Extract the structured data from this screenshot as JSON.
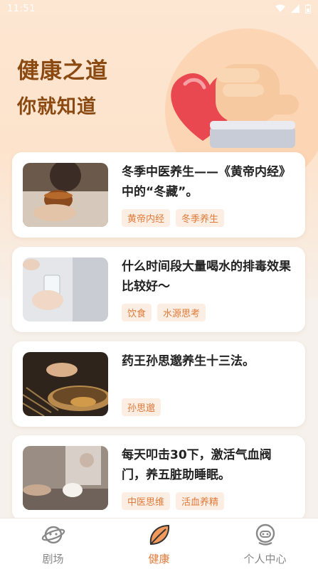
{
  "status_bar": {
    "time": "11:51"
  },
  "hero": {
    "line1": "健康之道",
    "line2": "你就知道"
  },
  "articles": [
    {
      "title": "冬季中医养生——《黄帝内经》中的“冬藏”。",
      "tags": [
        "黄帝内经",
        "冬季养生"
      ]
    },
    {
      "title": "什么时间段大量喝水的排毒效果比较好～",
      "tags": [
        "饮食",
        "水源思考"
      ]
    },
    {
      "title": "药王孙思邈养生十三法。",
      "tags": [
        "孙思邈"
      ]
    },
    {
      "title": "每天叩击30下，激活气血阀门，养五脏助睡眠。",
      "tags": [
        "中医思维",
        "活血养精"
      ]
    }
  ],
  "tabbar": {
    "items": [
      {
        "label": "剧场",
        "icon": "planet-icon"
      },
      {
        "label": "健康",
        "icon": "leaf-icon"
      },
      {
        "label": "个人中心",
        "icon": "robot-icon"
      }
    ],
    "active_index": 1
  },
  "colors": {
    "accent": "#e07a3a",
    "headline": "#8a4a12",
    "tag_bg": "#fdeee3"
  }
}
